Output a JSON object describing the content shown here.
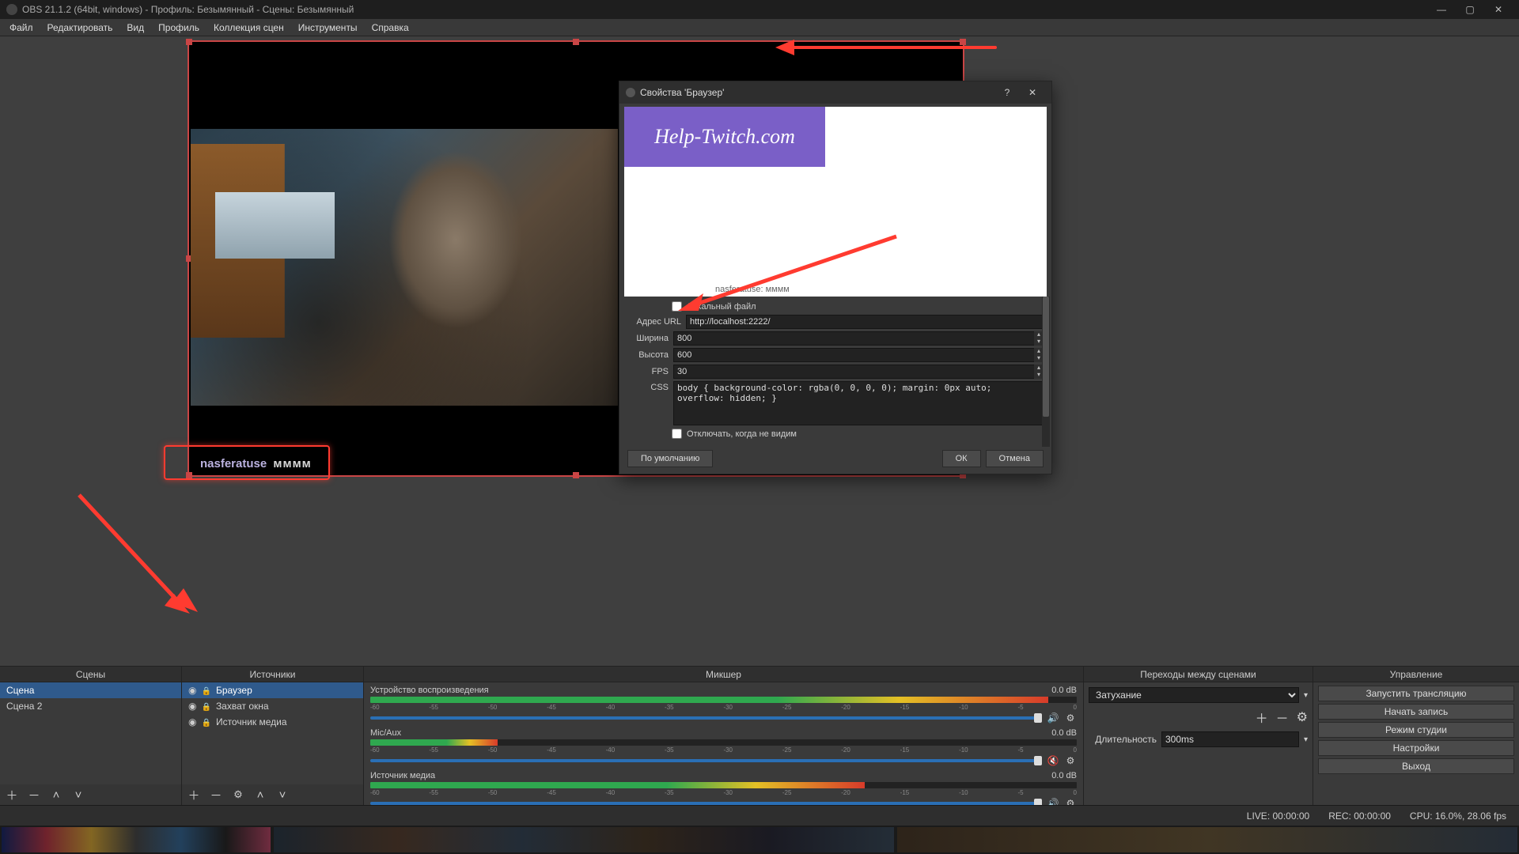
{
  "title": "OBS 21.1.2 (64bit, windows) - Профиль: Безымянный - Сцены: Безымянный",
  "menu": [
    "Файл",
    "Редактировать",
    "Вид",
    "Профиль",
    "Коллекция сцен",
    "Инструменты",
    "Справка"
  ],
  "preview": {
    "chat_user": "nasferatuse",
    "chat_msg": "мммм"
  },
  "dialog": {
    "title": "Свойства 'Браузер'",
    "banner": "Help-Twitch.com",
    "preview_chat": "nasferatuse: мммм",
    "local_file_label": "Локальный файл",
    "url_label": "Адрес URL",
    "url_value": "http://localhost:2222/",
    "width_label": "Ширина",
    "width_value": "800",
    "height_label": "Высота",
    "height_value": "600",
    "fps_label": "FPS",
    "fps_value": "30",
    "css_label": "CSS",
    "css_value": "body { background-color: rgba(0, 0, 0, 0); margin: 0px auto; overflow: hidden; }",
    "shutdown_label": "Отключать, когда не видим",
    "defaults_btn": "По умолчанию",
    "ok_btn": "ОК",
    "cancel_btn": "Отмена"
  },
  "docks": {
    "scenes_hdr": "Сцены",
    "sources_hdr": "Источники",
    "mixer_hdr": "Микшер",
    "trans_hdr": "Переходы между сценами",
    "controls_hdr": "Управление"
  },
  "scenes": [
    "Сцена",
    "Сцена 2"
  ],
  "sources": [
    "Браузер",
    "Захват окна",
    "Источник медиа"
  ],
  "mixer": {
    "tracks": [
      {
        "name": "Устройство воспроизведения",
        "db": "0.0 dB",
        "fill": 96,
        "muted": false
      },
      {
        "name": "Mic/Aux",
        "db": "0.0 dB",
        "fill": 18,
        "muted": true
      },
      {
        "name": "Источник медиа",
        "db": "0.0 dB",
        "fill": 70,
        "muted": false
      }
    ],
    "scale": [
      "-60",
      "-55",
      "-50",
      "-45",
      "-40",
      "-35",
      "-30",
      "-25",
      "-20",
      "-15",
      "-10",
      "-5",
      "0"
    ]
  },
  "transitions": {
    "type_label": "",
    "type_value": "Затухание",
    "dur_label": "Длительность",
    "dur_value": "300ms"
  },
  "controls": [
    "Запустить трансляцию",
    "Начать запись",
    "Режим студии",
    "Настройки",
    "Выход"
  ],
  "status": {
    "live": "LIVE: 00:00:00",
    "rec": "REC: 00:00:00",
    "cpu": "CPU: 16.0%, 28.06 fps"
  }
}
